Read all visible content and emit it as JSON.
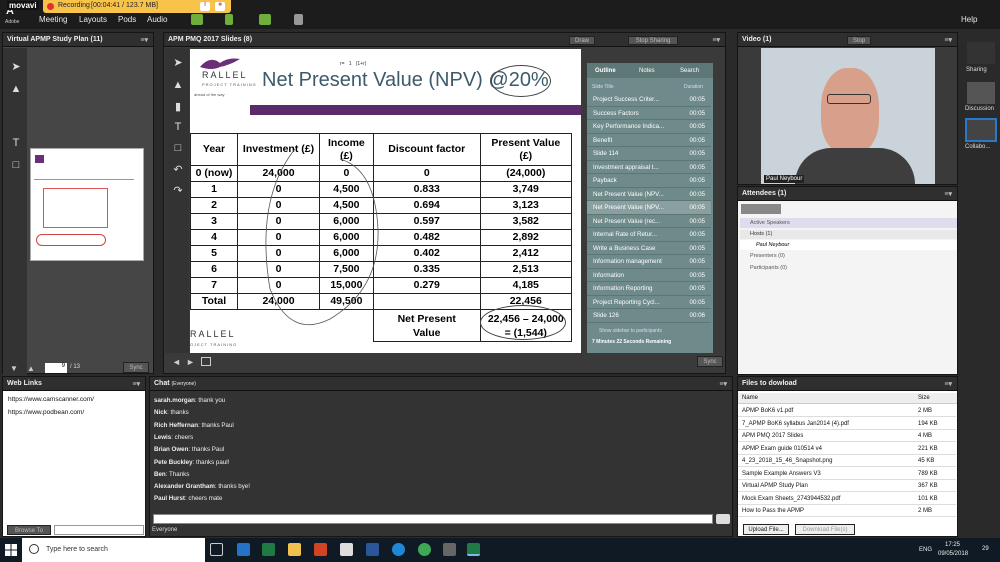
{
  "menubar": {
    "brand": "movavi",
    "adobe_label": "Adobe",
    "recording_label": "Recording",
    "recording_info": "[00:04:41 / 123.7 MB]",
    "menu_items": [
      "Meeting",
      "Layouts",
      "Pods",
      "Audio"
    ],
    "help_label": "Help"
  },
  "study_plan_pod": {
    "title": "Virtual APMP Study Plan (11)",
    "page_current": "9",
    "page_total": "/ 13",
    "sync_label": "Sync"
  },
  "slides_pod": {
    "title": "APM PMQ 2017 Slides (8)",
    "draw_label": "Draw",
    "stop_sharing_label": "Stop Sharing",
    "sync_label": "Sync"
  },
  "slide": {
    "logo_text_top": "RALLEL",
    "logo_text_sub": "PROJECT TRAINING",
    "logo_tagline": "ahead of the way",
    "title": "Net Present Value (NPV) @20%",
    "formula": "r=   1   (1+r)",
    "logo_bottom_top": "RALLEL",
    "logo_bottom_sub": "OJECT TRAINING",
    "table": {
      "headers": [
        "Year",
        "Investment (£)",
        "Income (£)",
        "Discount factor",
        "Present Value (£)"
      ],
      "rows": [
        [
          "0 (now)",
          "24,000",
          "0",
          "0",
          "(24,000)"
        ],
        [
          "1",
          "0",
          "4,500",
          "0.833",
          "3,749"
        ],
        [
          "2",
          "0",
          "4,500",
          "0.694",
          "3,123"
        ],
        [
          "3",
          "0",
          "6,000",
          "0.597",
          "3,582"
        ],
        [
          "4",
          "0",
          "6,000",
          "0.482",
          "2,892"
        ],
        [
          "5",
          "0",
          "6,000",
          "0.402",
          "2,412"
        ],
        [
          "6",
          "0",
          "7,500",
          "0.335",
          "2,513"
        ],
        [
          "7",
          "0",
          "15,000",
          "0.279",
          "4,185"
        ],
        [
          "Total",
          "24,000",
          "49,500",
          "",
          "22,456"
        ]
      ],
      "npv_label": "Net Present Value",
      "npv_value": "22,456 – 24,000 = (1,544)"
    }
  },
  "outline_panel": {
    "tabs": [
      "Outline",
      "Notes",
      "Search"
    ],
    "col_title": "Slide Title",
    "col_duration": "Duration",
    "items": [
      {
        "title": "Project Success Criter...",
        "duration": "00:05"
      },
      {
        "title": "Success Factors",
        "duration": "00:05"
      },
      {
        "title": "Key Performance Indica...",
        "duration": "00:05"
      },
      {
        "title": "Benefit",
        "duration": "00:05"
      },
      {
        "title": "Slide 114",
        "duration": "00:05"
      },
      {
        "title": "Investment appraisal t...",
        "duration": "00:05"
      },
      {
        "title": "Payback",
        "duration": "00:05"
      },
      {
        "title": "Net Present Value (NPV...",
        "duration": "00:05"
      },
      {
        "title": "Net Present Value (NPV...",
        "duration": "00:05"
      },
      {
        "title": "Net Present Value (rec...",
        "duration": "00:05"
      },
      {
        "title": "Internal Rate of Retur...",
        "duration": "00:05"
      },
      {
        "title": "Write a Business Case",
        "duration": "00:05"
      },
      {
        "title": "Information management",
        "duration": "00:05"
      },
      {
        "title": "Information",
        "duration": "00:05"
      },
      {
        "title": "Information Reporting",
        "duration": "00:05"
      },
      {
        "title": "Project Reporting Cycl...",
        "duration": "00:05"
      },
      {
        "title": "Slide 126",
        "duration": "00:06"
      }
    ],
    "show_sidebar": "Show sidebar to participants",
    "remaining": "7 Minutes 22 Seconds Remaining"
  },
  "video_pod": {
    "title": "Video (1)",
    "stop_label": "Stop",
    "speaker_name": "Paul Neybour"
  },
  "attendees_pod": {
    "title": "Attendees (1)",
    "active_speakers": "Active Speakers",
    "hosts": "Hosts (1)",
    "host_name": "Paul Neybour",
    "presenters": "Presenters (0)",
    "participants": "Participants (0)"
  },
  "right_rail": {
    "items": [
      "Sharing",
      "Discussion",
      "Collabo..."
    ]
  },
  "weblinks_pod": {
    "title": "Web Links",
    "links": [
      "https://www.camscanner.com/",
      "https://www.podbean.com/"
    ],
    "browse_label": "Browse To"
  },
  "chat_pod": {
    "title": "Chat",
    "audience": "(Everyone)",
    "messages": [
      {
        "name": "sarah.morgan",
        "text": "thank you"
      },
      {
        "name": "Nick",
        "text": "thanks"
      },
      {
        "name": "Rich Heffernan",
        "text": "thanks Paul"
      },
      {
        "name": "Lewis",
        "text": "cheers"
      },
      {
        "name": "Brian Owen",
        "text": "thanks Paul"
      },
      {
        "name": "Pete Buckley",
        "text": "thanks paul!"
      },
      {
        "name": "Ben",
        "text": "Thanks"
      },
      {
        "name": "Alexander Grantham",
        "text": "thanks bye!"
      },
      {
        "name": "Paul Hurst",
        "text": "cheers mate"
      }
    ],
    "tab_label": "Everyone"
  },
  "files_pod": {
    "title": "Files to dowload",
    "col_name": "Name",
    "col_size": "Size",
    "files": [
      {
        "name": "APMP BoK6 v1.pdf",
        "size": "2 MB"
      },
      {
        "name": "7_APMP BoK6 syllabus Jan2014 (4).pdf",
        "size": "194 KB"
      },
      {
        "name": "APM PMQ 2017 Slides",
        "size": "4 MB"
      },
      {
        "name": "APMP Exam guide 010514 v4",
        "size": "221 KB"
      },
      {
        "name": "4_23_2018_15_46_Snapshot.png",
        "size": "45 KB"
      },
      {
        "name": "Sample Example Answers V3",
        "size": "789 KB"
      },
      {
        "name": "Virtual APMP Study Plan",
        "size": "367 KB"
      },
      {
        "name": "Mock Exam Sheets_2743944532.pdf",
        "size": "101 KB"
      },
      {
        "name": "How to Pass the APMP",
        "size": "2 MB"
      }
    ],
    "upload_label": "Upload File...",
    "download_label": "Download File(s)"
  },
  "taskbar": {
    "search_placeholder": "Type here to search",
    "lang": "ENG",
    "time": "17:25",
    "date": "09/05/2018",
    "notification_count": "29"
  },
  "colors": {
    "slide_title": "#3d5a6b",
    "purple_bar": "#5a2a6c",
    "outline_bg": "#6f8a8a",
    "recording_bg": "#f7c34a"
  }
}
